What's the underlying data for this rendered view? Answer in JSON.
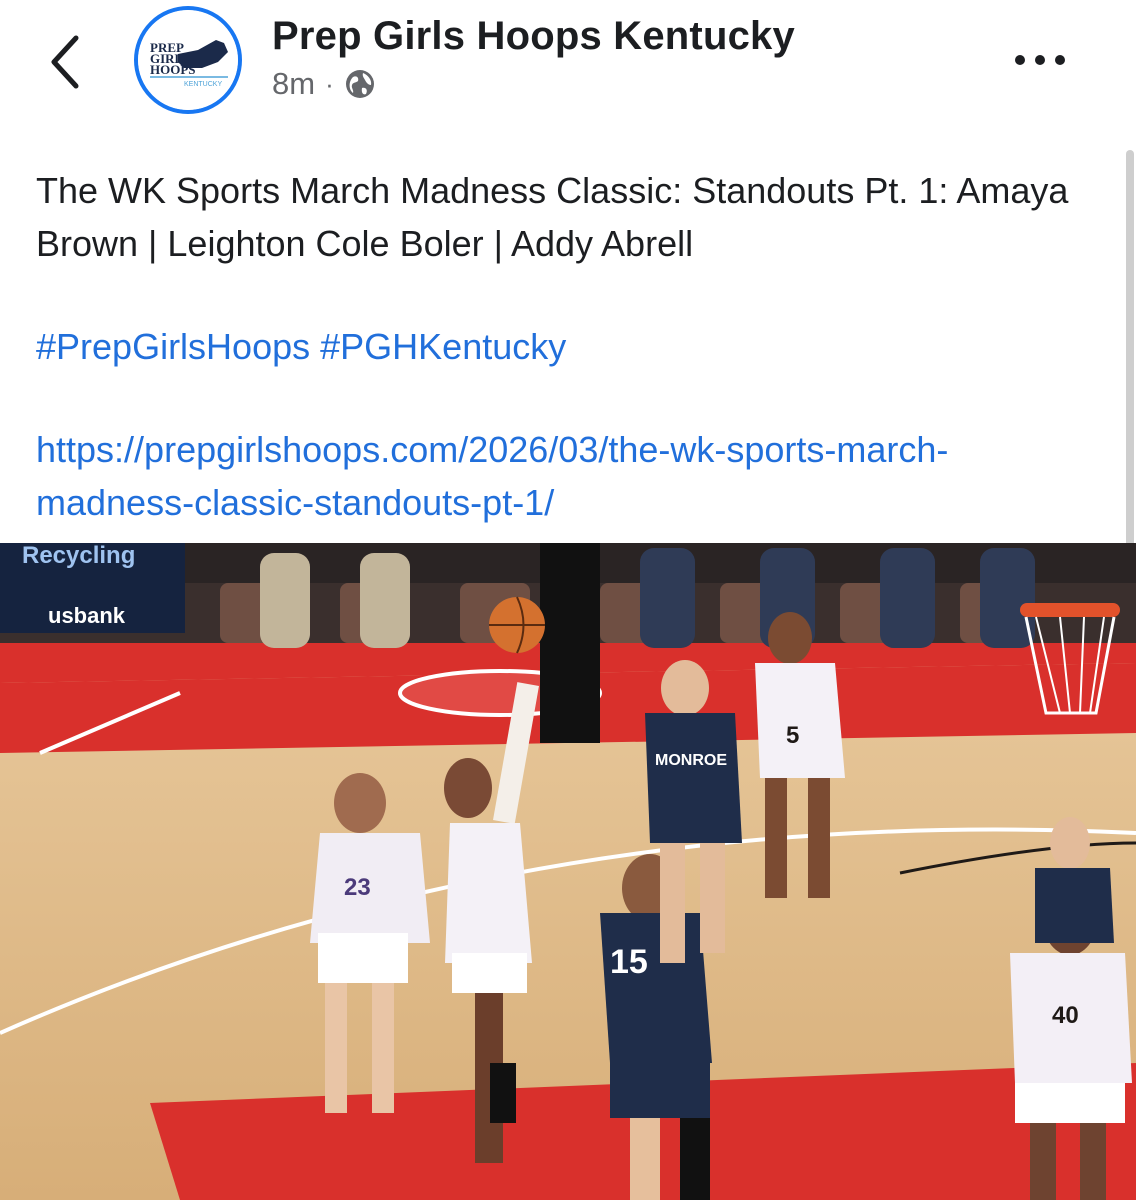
{
  "header": {
    "page_name": "Prep Girls Hoops Kentucky",
    "time_ago": "8m",
    "separator": "·",
    "audience_icon": "globe-icon",
    "back_icon": "chevron-left-icon",
    "more_icon": "more-horizontal-icon"
  },
  "avatar": {
    "logo_lines": [
      "PREP",
      "GIRLS",
      "HOOPS"
    ],
    "logo_sub": "KENTUCKY",
    "ring_color": "#1877f2"
  },
  "post": {
    "text": "The WK Sports March Madness Classic: Standouts Pt. 1: Amaya Brown | Leighton Cole Boler | Addy Abrell",
    "hashtags": [
      "#PrepGirlsHoops",
      "#PGHKentucky"
    ],
    "link": "https://prepgirlshoops.com/2026/03/the-wk-sports-march-madness-classic-standouts-pt-1/"
  },
  "photo": {
    "arena_sign": "Recycling",
    "bank_sign": "usbank",
    "jersey_numbers": [
      "5",
      "23",
      "15",
      "40"
    ],
    "team_text": "MONROE",
    "court_color": "#d9302c",
    "away_jersey_color": "#1f2d4a"
  }
}
